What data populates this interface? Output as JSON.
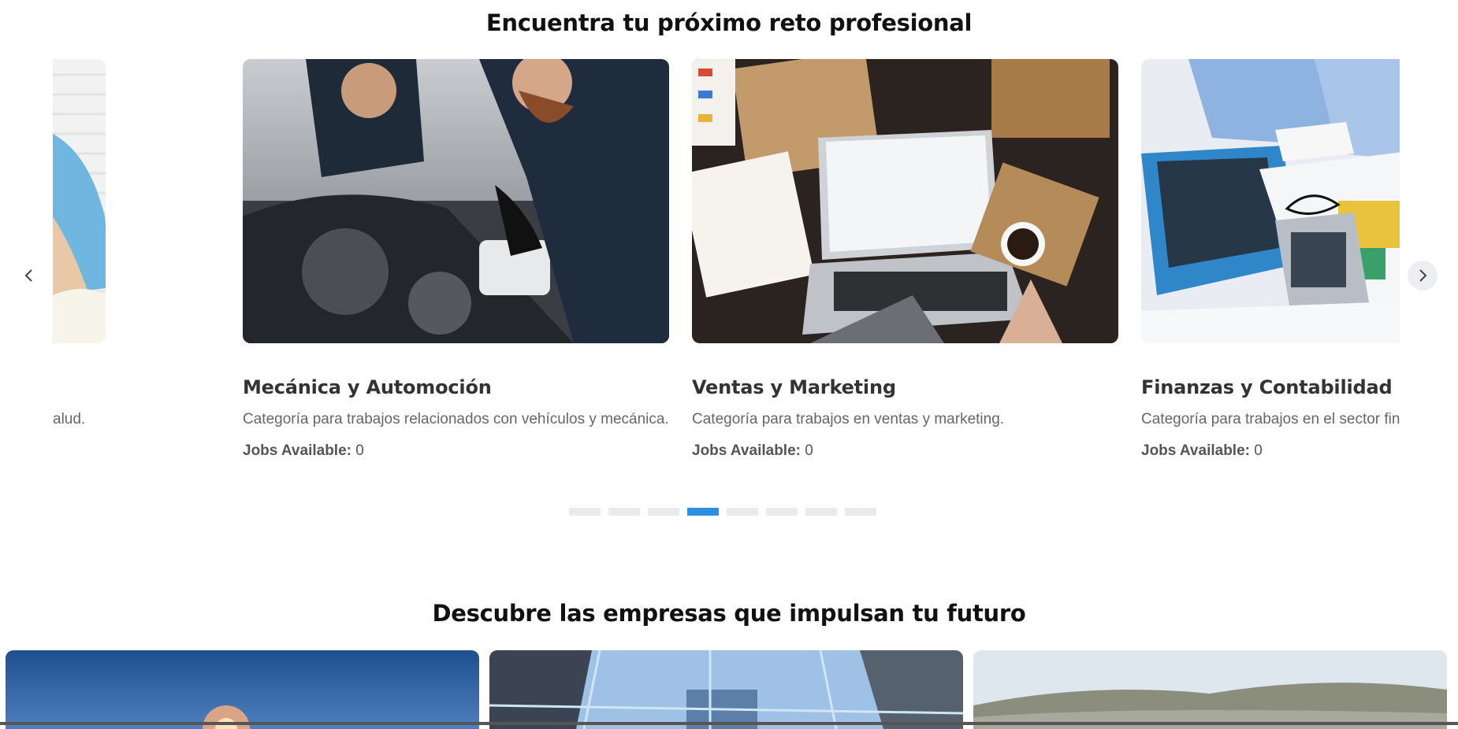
{
  "sections": {
    "top_title": "Encuentra tu próximo reto profesional",
    "bottom_title": "Descubre las empresas que impulsan tu futuro"
  },
  "categories": {
    "partial_left": {
      "desc": "alud."
    },
    "items": [
      {
        "title": "Mecánica y Automoción",
        "desc": "Categoría para trabajos relacionados con vehículos y mecánica.",
        "jobs_label": "Jobs Available:",
        "jobs_count": "0"
      },
      {
        "title": "Ventas y Marketing",
        "desc": "Categoría para trabajos en ventas y marketing.",
        "jobs_label": "Jobs Available:",
        "jobs_count": "0"
      },
      {
        "title": "Finanzas y Contabilidad",
        "desc": "Categoría para trabajos en el sector financiero",
        "jobs_label": "Jobs Available:",
        "jobs_count": "0"
      }
    ]
  },
  "pagination": {
    "total": 8,
    "active_index": 3
  },
  "icons": {
    "prev": "chevron-left-icon",
    "next": "chevron-right-icon"
  },
  "colors": {
    "accent": "#2b8fe3",
    "dot_inactive": "#e8eaed"
  }
}
